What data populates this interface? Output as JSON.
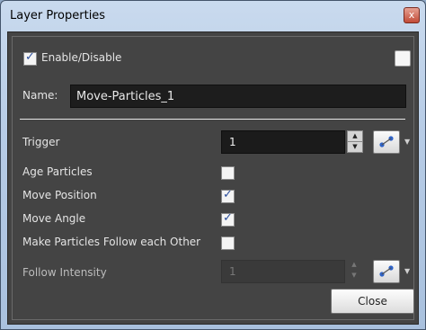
{
  "window": {
    "title": "Layer Properties",
    "close_glyph": "x"
  },
  "enable": {
    "label": "Enable/Disable",
    "checked": true
  },
  "name": {
    "label": "Name:",
    "value": "Move-Particles_1"
  },
  "trigger": {
    "label": "Trigger",
    "value": "1"
  },
  "options": [
    {
      "label": "Age Particles",
      "checked": false
    },
    {
      "label": "Move Position",
      "checked": true
    },
    {
      "label": "Move Angle",
      "checked": true
    },
    {
      "label": "Make Particles Follow each Other",
      "checked": false
    }
  ],
  "follow_intensity": {
    "label": "Follow Intensity",
    "value": "1",
    "enabled": false
  },
  "buttons": {
    "close": "Close"
  },
  "icons": {
    "function": "function-curve-icon",
    "dropdown": "chevron-down-icon"
  }
}
